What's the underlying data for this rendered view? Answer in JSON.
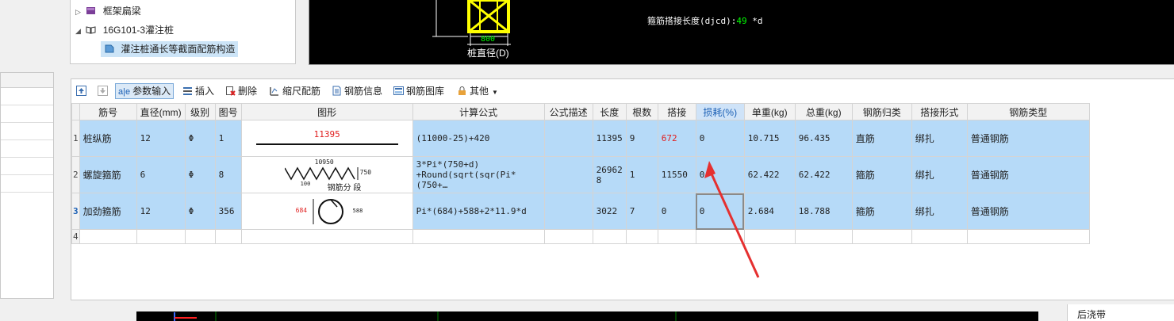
{
  "tree": {
    "items": [
      {
        "label": "框架扁梁",
        "arrow": "▷"
      },
      {
        "label": "16G101-3灌注桩",
        "arrow": "◢"
      },
      {
        "label": "灌注桩通长等截面配筋构造",
        "arrow": ""
      }
    ]
  },
  "cad_top": {
    "dim_text": "800",
    "pile_label": "桩直径(D)",
    "lap_label": "箍筋搭接长度(djcd):",
    "lap_value": "49",
    "lap_suffix": " *d"
  },
  "toolbar": {
    "param_input": "参数输入",
    "insert": "插入",
    "delete": "删除",
    "scale": "缩尺配筋",
    "info": "钢筋信息",
    "library": "钢筋图库",
    "other": "其他"
  },
  "grid": {
    "headers": [
      "筋号",
      "直径(mm)",
      "级别",
      "图号",
      "图形",
      "计算公式",
      "公式描述",
      "长度",
      "根数",
      "搭接",
      "损耗(%)",
      "单重(kg)",
      "总重(kg)",
      "钢筋归类",
      "搭接形式",
      "钢筋类型"
    ],
    "rows": [
      {
        "num": "1",
        "name": "桩纵筋",
        "dia": "12",
        "grade": "Φ",
        "fig": "1",
        "shape_text": "11395",
        "formula": "(11000-25)+420",
        "formula2": "",
        "desc": "",
        "length": "11395",
        "count": "9",
        "lap": "672",
        "loss": "0",
        "unit_w": "10.715",
        "total_w": "96.435",
        "cat": "直筋",
        "lap_type": "绑扎",
        "type": "普通钢筋"
      },
      {
        "num": "2",
        "name": "螺旋箍筋",
        "dia": "6",
        "grade": "Φ",
        "fig": "8",
        "shape_text": "10950",
        "shape_text2": "750",
        "shape_text3": "100",
        "shape_text4": "钢筋分 段",
        "formula": "3*Pi*(750+d)",
        "formula2": "+Round(sqrt(sqr(Pi*(750+…",
        "desc": "",
        "length": "26962",
        "length2": "8",
        "count": "1",
        "lap": "11550",
        "loss": "0",
        "unit_w": "62.422",
        "total_w": "62.422",
        "cat": "箍筋",
        "lap_type": "绑扎",
        "type": "普通钢筋"
      },
      {
        "num": "3",
        "name": "加劲箍筋",
        "dia": "12",
        "grade": "Φ",
        "fig": "356",
        "shape_text": "684",
        "shape_text2": "588",
        "formula": "Pi*(684)+588+2*11.9*d",
        "formula2": "",
        "desc": "",
        "length": "3022",
        "count": "7",
        "lap": "0",
        "loss": "0",
        "unit_w": "2.684",
        "total_w": "18.788",
        "cat": "箍筋",
        "lap_type": "绑扎",
        "type": "普通钢筋"
      },
      {
        "num": "4"
      }
    ]
  },
  "bottom": {
    "right_text": "后浇带"
  }
}
